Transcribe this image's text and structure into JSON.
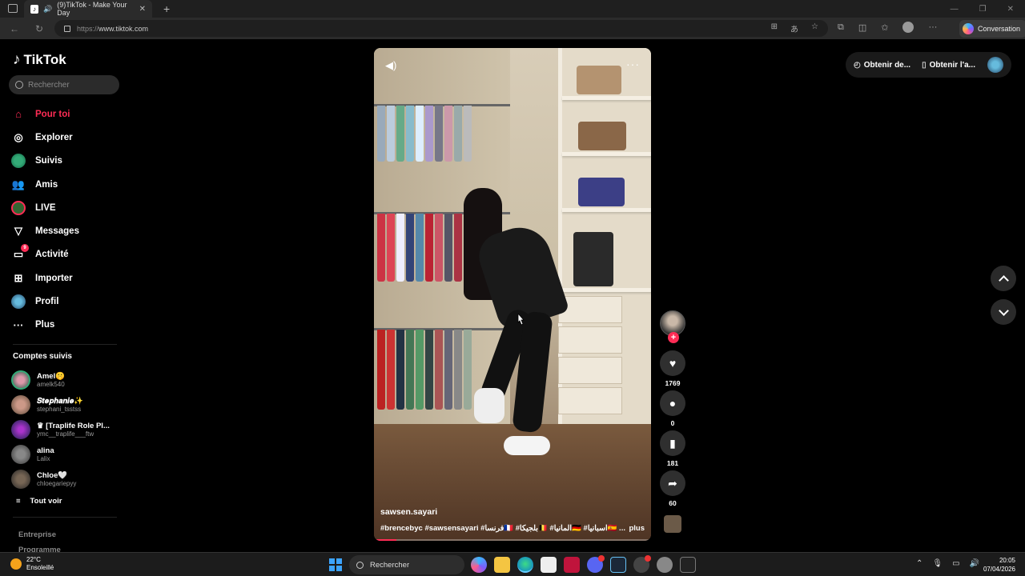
{
  "browser": {
    "tab_title": "(9)TikTok - Make Your Day",
    "url_prefix": "https://",
    "url_host": "www.tiktok.com",
    "conversation_label": "Conversation"
  },
  "sidebar": {
    "brand": "TikTok",
    "search_placeholder": "Rechercher",
    "nav": [
      {
        "label": "Pour toi",
        "icon": "home-icon",
        "active": true
      },
      {
        "label": "Explorer",
        "icon": "compass-icon"
      },
      {
        "label": "Suivis",
        "icon": "following-avatar-icon"
      },
      {
        "label": "Amis",
        "icon": "friends-icon"
      },
      {
        "label": "LIVE",
        "icon": "live-icon"
      },
      {
        "label": "Messages",
        "icon": "messages-icon"
      },
      {
        "label": "Activité",
        "icon": "activity-icon",
        "badge": "9"
      },
      {
        "label": "Importer",
        "icon": "upload-icon"
      },
      {
        "label": "Profil",
        "icon": "profile-avatar-icon"
      },
      {
        "label": "Plus",
        "icon": "more-icon"
      }
    ],
    "followed_title": "Comptes suivis",
    "followed": [
      {
        "name": "Amel🤫",
        "user": "amelk540"
      },
      {
        "name": "𝑺𝒕𝒆𝒑𝒉𝒂𝒏𝒊𝒆✨",
        "user": "stephani_tsstss"
      },
      {
        "name": "♛ [Traplife Role Pl...",
        "user": "ymc__traplife___ftw"
      },
      {
        "name": "alina",
        "user": "Lalix"
      },
      {
        "name": "Chloe🤍",
        "user": "chloegariepyy"
      }
    ],
    "see_all": "Tout voir",
    "footer": [
      "Entreprise",
      "Programme"
    ]
  },
  "video": {
    "author": "sawsen.sayari",
    "tags": "#brencebyc #sawsensayari #فرنسا🇫🇷 #بلجيكا🇧🇪 #المانيا🇩🇪 #اسبانيا🇪🇸 ...",
    "more_label": "plus",
    "progress": 0.08
  },
  "actions": {
    "likes": "1769",
    "comments": "0",
    "saves": "181",
    "shares": "60"
  },
  "topright": {
    "get_coins": "Obtenir de...",
    "get_app": "Obtenir l'a..."
  },
  "taskbar": {
    "temp": "22°C",
    "weather": "Ensoleillé",
    "search": "Rechercher",
    "time": "20:05",
    "date": "07/04/2026"
  }
}
